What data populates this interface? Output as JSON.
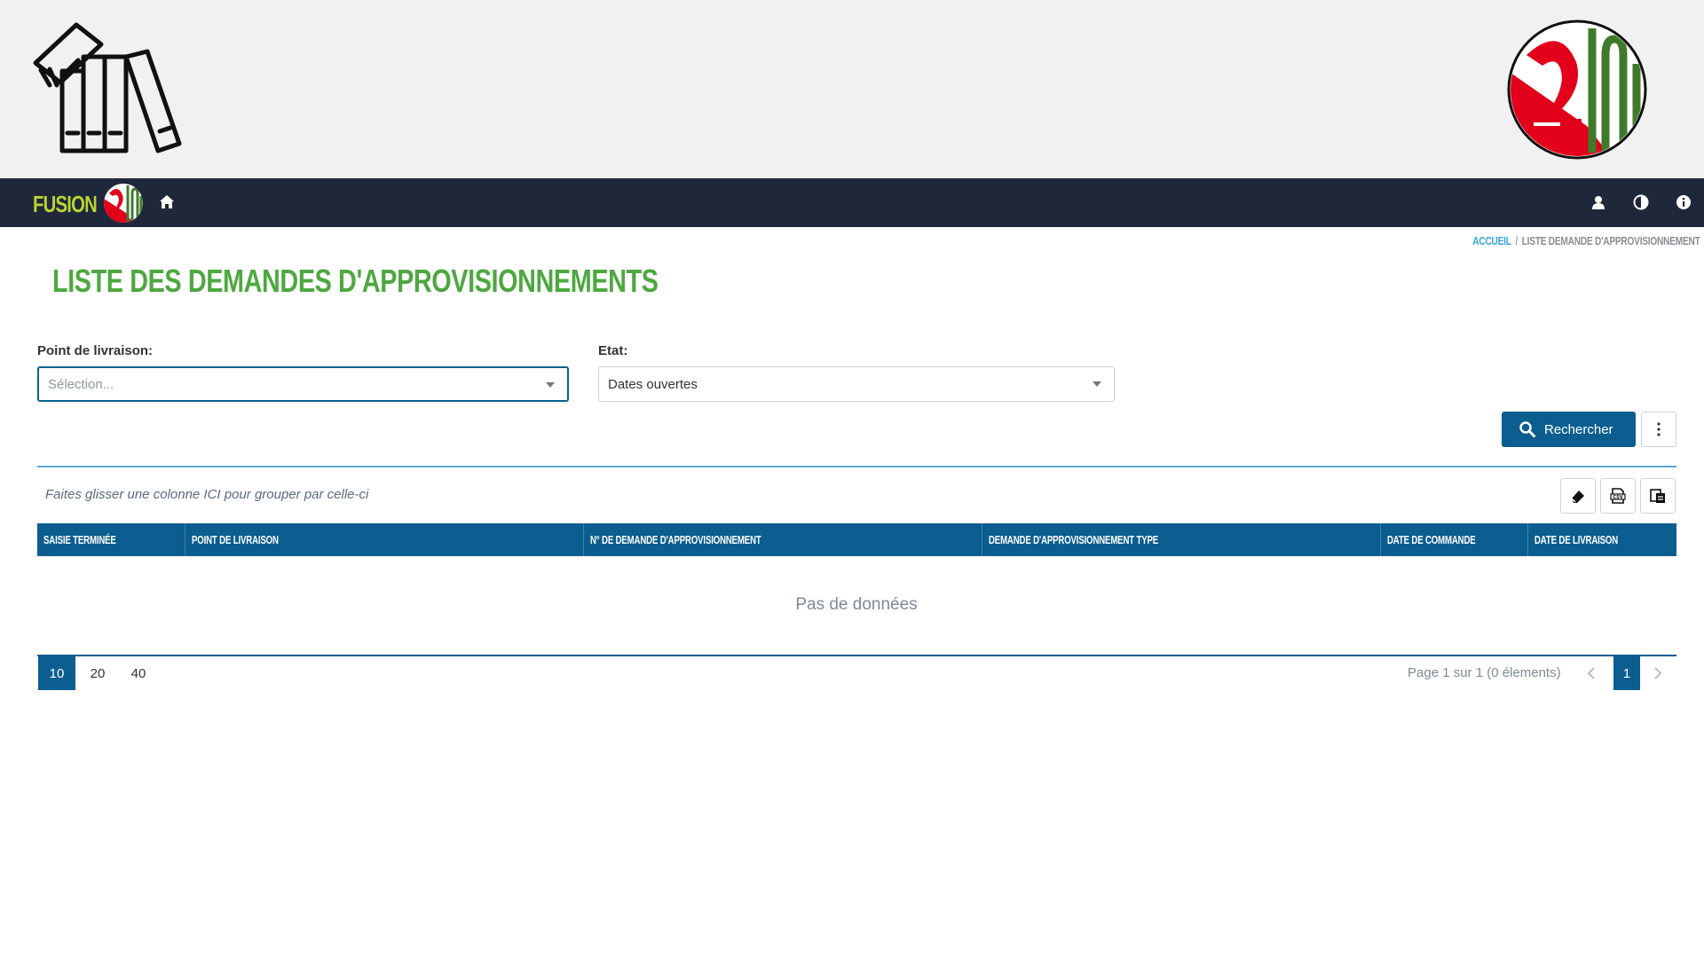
{
  "navbar": {
    "brand": "FUSION",
    "icons": [
      "home-icon",
      "user-icon",
      "contrast-icon",
      "info-icon"
    ]
  },
  "breadcrumb": {
    "home": "ACCUEIL",
    "separator": "/",
    "current": "LISTE DEMANDE D'APPROVISIONNEMENT"
  },
  "page": {
    "title": "LISTE DES DEMANDES D'APPROVISIONNEMENTS"
  },
  "filters": {
    "delivery_point": {
      "label": "Point de livraison:",
      "placeholder": "Sélection..."
    },
    "state": {
      "label": "Etat:",
      "value": "Dates ouvertes"
    },
    "search_label": "Rechercher"
  },
  "grid": {
    "group_hint": "Faites glisser une colonne ICI pour grouper par celle-ci",
    "columns": [
      "SAISIE TERMINÉE",
      "POINT DE LIVRAISON",
      "N° DE DEMANDE D'APPROVISIONNEMENT",
      "DEMANDE D'APPROVISIONNEMENT TYPE",
      "DATE DE COMMANDE",
      "DATE DE LIVRAISON"
    ],
    "empty_text": "Pas de données",
    "toolbar_icons": [
      "eraser-icon",
      "csv-export-icon",
      "column-chooser-icon"
    ]
  },
  "pager": {
    "page_sizes": [
      "10",
      "20",
      "40"
    ],
    "active_page_size": "10",
    "info": "Page 1 sur 1 (0 élements)",
    "current_page": "1"
  },
  "colors": {
    "navbar": "#1f273a",
    "primary": "#0b5e8f",
    "title_green": "#4da840",
    "brand_lime": "#b9d432",
    "logo_red": "#e2001a",
    "logo_green": "#3f7a2c"
  }
}
